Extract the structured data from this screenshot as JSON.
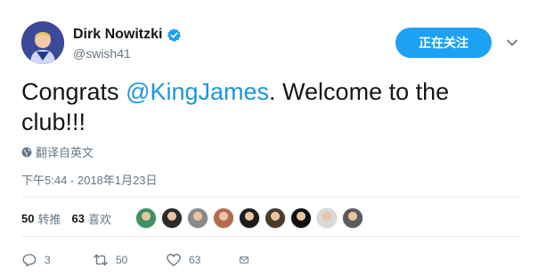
{
  "user": {
    "display_name": "Dirk Nowitzki",
    "handle": "@swish41",
    "verified": true
  },
  "follow_button": {
    "label": "正在关注"
  },
  "tweet": {
    "text_before": "Congrats ",
    "mention": "@KingJames",
    "text_after": ". Welcome to the club!!!",
    "translate_label": "翻译自英文",
    "timestamp": "下午5:44 - 2018年1月23日"
  },
  "stats": {
    "retweets_count": "50",
    "retweets_label": "转推",
    "likes_count": "63",
    "likes_label": "喜欢",
    "liker_avatar_colors": [
      "#3f8e64",
      "#2a2a2a",
      "#8a8a8a",
      "#b36b4e",
      "#1c1c1c",
      "#4a3a2a",
      "#111111",
      "#d9d9d9",
      "#5a5a5a"
    ]
  },
  "actions": {
    "reply_count": "3",
    "retweet_count": "50",
    "like_count": "63"
  },
  "colors": {
    "accent": "#1da1f2",
    "link": "#1b95e0",
    "secondary_text": "#657786"
  }
}
